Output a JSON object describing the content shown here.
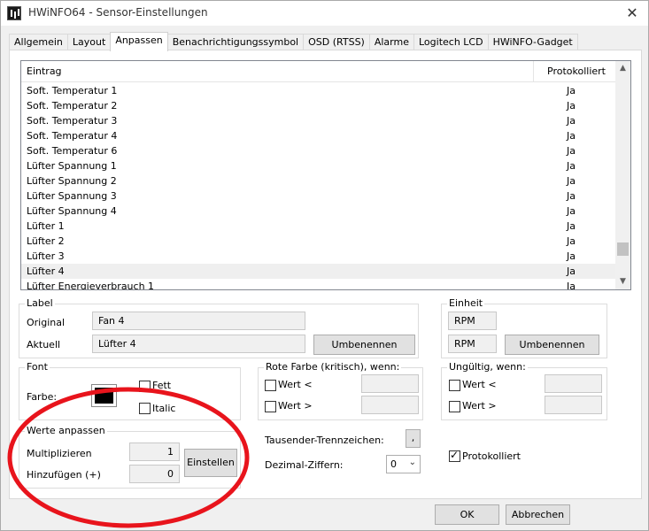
{
  "window": {
    "title": "HWiNFO64 - Sensor-Einstellungen"
  },
  "tabs": [
    {
      "label": "Allgemein"
    },
    {
      "label": "Layout"
    },
    {
      "label": "Anpassen"
    },
    {
      "label": "Benachrichtigungssymbol"
    },
    {
      "label": "OSD (RTSS)"
    },
    {
      "label": "Alarme"
    },
    {
      "label": "Logitech LCD"
    },
    {
      "label": "HWiNFO-Gadget"
    }
  ],
  "active_tab": "Anpassen",
  "list": {
    "col_entry": "Eintrag",
    "col_logged": "Protokolliert",
    "rows": [
      {
        "entry": "Soft. Temperatur 1",
        "logged": "Ja"
      },
      {
        "entry": "Soft. Temperatur 2",
        "logged": "Ja"
      },
      {
        "entry": "Soft. Temperatur 3",
        "logged": "Ja"
      },
      {
        "entry": "Soft. Temperatur 4",
        "logged": "Ja"
      },
      {
        "entry": "Soft. Temperatur 6",
        "logged": "Ja"
      },
      {
        "entry": "Lüfter Spannung 1",
        "logged": "Ja"
      },
      {
        "entry": "Lüfter Spannung 2",
        "logged": "Ja"
      },
      {
        "entry": "Lüfter Spannung 3",
        "logged": "Ja"
      },
      {
        "entry": "Lüfter Spannung 4",
        "logged": "Ja"
      },
      {
        "entry": "Lüfter 1",
        "logged": "Ja"
      },
      {
        "entry": "Lüfter 2",
        "logged": "Ja"
      },
      {
        "entry": "Lüfter 3",
        "logged": "Ja"
      },
      {
        "entry": "Lüfter 4",
        "logged": "Ja"
      },
      {
        "entry": "Lüfter Energieverbrauch 1",
        "logged": "Ja"
      }
    ],
    "selected_index": 12
  },
  "label_group": {
    "legend": "Label",
    "original_label": "Original",
    "original_value": "Fan 4",
    "current_label": "Aktuell",
    "current_value": "Lüfter 4",
    "rename_button": "Umbenennen"
  },
  "unit_group": {
    "legend": "Einheit",
    "original_value": "RPM",
    "current_value": "RPM",
    "rename_button": "Umbenennen"
  },
  "font_group": {
    "legend": "Font",
    "color_label": "Farbe:",
    "color": "#000000",
    "bold_label": "Fett",
    "bold_checked": false,
    "italic_label": "Italic",
    "italic_checked": false
  },
  "red_group": {
    "legend": "Rote Farbe (kritisch), wenn:",
    "value_lt_label": "Wert <",
    "value_gt_label": "Wert >",
    "value_lt": "",
    "value_gt": ""
  },
  "invalid_group": {
    "legend": "Ungültig, wenn:",
    "value_lt_label": "Wert <",
    "value_gt_label": "Wert >",
    "value_lt": "",
    "value_gt": ""
  },
  "adjust_group": {
    "legend": "Werte anpassen",
    "multiply_label": "Multiplizieren",
    "multiply_value": "1",
    "add_label": "Hinzufügen (+)",
    "add_value": "0",
    "set_button": "Einstellen"
  },
  "thousands_sep": {
    "label": "Tausender-Trennzeichen:",
    "value": ","
  },
  "decimal_digits": {
    "label": "Dezimal-Ziffern:",
    "value": "0"
  },
  "logged_checkbox": {
    "label": "Protokolliert",
    "checked": true
  },
  "footer": {
    "ok": "OK",
    "cancel": "Abbrechen"
  },
  "colors": {
    "annotation_red": "#e8141c",
    "selected_row": "#efefef"
  },
  "icons": [
    "app-icon",
    "close-icon",
    "scroll-up-icon",
    "scroll-down-icon",
    "combo-arrow-icon"
  ]
}
